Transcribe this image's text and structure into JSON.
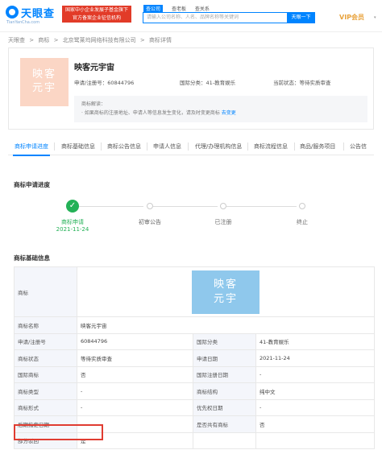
{
  "header": {
    "logo_text": "天眼查",
    "logo_url": "TianYanCha.com",
    "banner_line1": "国家中小企业发展子基金旗下",
    "banner_line2": "官方备案企业征信机构",
    "search_tabs": [
      "查公司",
      "查老板",
      "查关系"
    ],
    "search_placeholder": "请输入公司名称、人名、品牌名称等关键词",
    "search_button": "天眼一下",
    "vip_label": "VIP会员",
    "vip_caret": "▾"
  },
  "breadcrumb": [
    "天眼查",
    ">",
    "商标",
    ">",
    "北京鹭莱坞网络科技有限公司",
    ">",
    "商标详情"
  ],
  "summary": {
    "thumb_text_line1": "映客",
    "thumb_text_line2": "元宇",
    "name": "映客元宇宙",
    "reg_no": "申请/注册号：60844796",
    "intl_class": "国际分类：41-教育娱乐",
    "status": "当前状态：等待实质审查",
    "notice_title": "商标解读：",
    "notice_body": "· 如果商标的注册地址、申请人等信息发生变化，请及时变更商标",
    "notice_link": "去变更"
  },
  "tabs": [
    "商标申请进度",
    "商标基础信息",
    "商标公告信息",
    "申请人信息",
    "代理/办理机构信息",
    "商标流程信息",
    "商品/服务项目",
    "公告信"
  ],
  "progress": {
    "title": "商标申请进度",
    "check": "✓",
    "steps": [
      {
        "label": "商标申请",
        "date": "2021-11-24"
      },
      {
        "label": "初审公告",
        "date": ""
      },
      {
        "label": "已注册",
        "date": ""
      },
      {
        "label": "终止",
        "date": ""
      }
    ]
  },
  "basic": {
    "title": "商标基础信息",
    "trademark_label": "商标",
    "thumb_line1": "映客",
    "thumb_line2": "元宇",
    "rows": [
      {
        "k1": "商标名称",
        "v1": "映客元宇宙",
        "k2": "",
        "v2": ""
      },
      {
        "k1": "申请/注册号",
        "v1": "60844796",
        "k2": "国际分类",
        "v2": "41-教育娱乐"
      },
      {
        "k1": "商标状态",
        "v1": "等待实质审查",
        "k2": "申请日期",
        "v2": "2021-11-24"
      },
      {
        "k1": "国际商标",
        "v1": "否",
        "k2": "国际注册日期",
        "v2": "-"
      },
      {
        "k1": "商标类型",
        "v1": "-",
        "k2": "商标结构",
        "v2": "纯中文"
      },
      {
        "k1": "商标形式",
        "v1": "-",
        "k2": "优先权日期",
        "v2": "-"
      },
      {
        "k1": "后期指定日期",
        "v1": "-",
        "k2": "是否共有商标",
        "v2": "否"
      },
      {
        "k1": "部分驳回",
        "v1": "是",
        "k2": "",
        "v2": ""
      }
    ]
  },
  "colors": {
    "brand": "#0084ff",
    "success": "#24b157",
    "highlight": "#e03c31",
    "vip": "#e8a33d"
  }
}
